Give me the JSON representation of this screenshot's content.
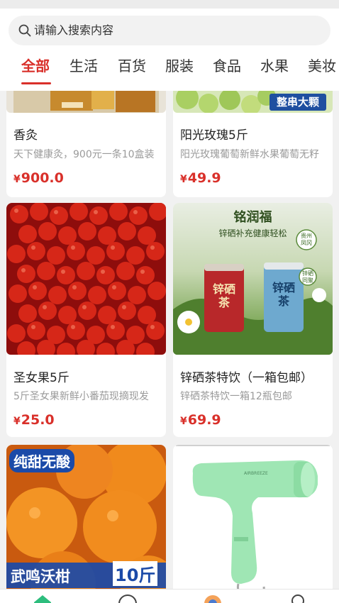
{
  "search": {
    "placeholder": "请输入搜索内容",
    "icon": "search-icon"
  },
  "tabs": [
    {
      "label": "全部",
      "active": true
    },
    {
      "label": "生活"
    },
    {
      "label": "百货"
    },
    {
      "label": "服装"
    },
    {
      "label": "食品"
    },
    {
      "label": "水果"
    },
    {
      "label": "美妆"
    }
  ],
  "products": [
    {
      "title": "香灸",
      "desc": "天下健康灸，900元一条10盒装",
      "currency": "¥",
      "price": "900.0"
    },
    {
      "title": "阳光玫瑰5斤",
      "desc": "阳光玫瑰葡萄新鲜水果葡萄无籽",
      "currency": "¥",
      "price": "49.9",
      "badge": "整串大颗"
    },
    {
      "title": "圣女果5斤",
      "desc": "5斤圣女果新鲜小番茄现摘现发",
      "currency": "¥",
      "price": "25.0"
    },
    {
      "title": "锌硒茶特饮（一箱包邮）",
      "desc": "锌硒茶特饮一箱12瓶包邮",
      "currency": "¥",
      "price": "69.9",
      "image_text": {
        "brand": "铭润福",
        "slogan": "锌硒补充健康轻松",
        "can1": "锌硒茶",
        "can2": "锌硒茶",
        "tag1": "贵州凤冈",
        "tag2": "锌硒同聚"
      }
    },
    {
      "image_text": {
        "top": "纯甜无酸",
        "bottom": "武鸣沃柑",
        "weight": "10斤"
      }
    },
    {
      "image_text": {}
    }
  ],
  "nav": [
    "home-icon",
    "message-icon",
    "category-icon",
    "profile-icon"
  ],
  "colors": {
    "accent": "#d9302a",
    "price": "#d9302a",
    "badge": "#1f4fa0"
  }
}
